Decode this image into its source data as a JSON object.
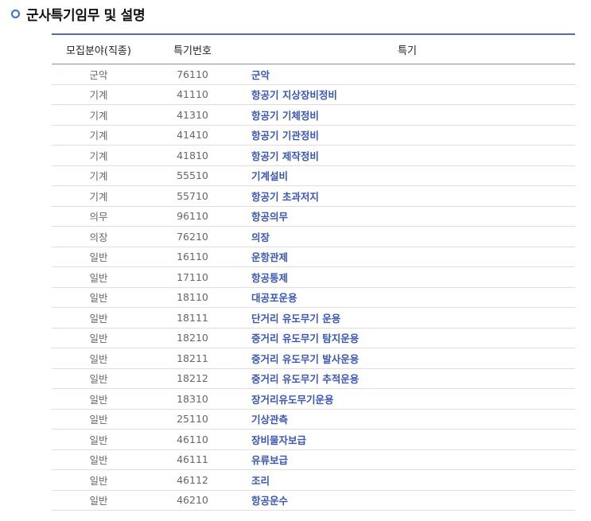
{
  "section": {
    "title": "군사특기임무 및 설명"
  },
  "table": {
    "headers": [
      "모집분야(직종)",
      "특기번호",
      "특기"
    ],
    "rows": [
      {
        "field": "군악",
        "code": "76110",
        "name": "군악"
      },
      {
        "field": "기계",
        "code": "41110",
        "name": "항공기 지상장비정비"
      },
      {
        "field": "기계",
        "code": "41310",
        "name": "항공기 기체정비"
      },
      {
        "field": "기계",
        "code": "41410",
        "name": "항공기 기관정비"
      },
      {
        "field": "기계",
        "code": "41810",
        "name": "항공기 제작정비"
      },
      {
        "field": "기계",
        "code": "55510",
        "name": "기계설비"
      },
      {
        "field": "기계",
        "code": "55710",
        "name": "항공기 초과저지"
      },
      {
        "field": "의무",
        "code": "96110",
        "name": "항공의무"
      },
      {
        "field": "의장",
        "code": "76210",
        "name": "의장"
      },
      {
        "field": "일반",
        "code": "16110",
        "name": "운항관제"
      },
      {
        "field": "일반",
        "code": "17110",
        "name": "항공통제"
      },
      {
        "field": "일반",
        "code": "18110",
        "name": "대공포운용"
      },
      {
        "field": "일반",
        "code": "18111",
        "name": "단거리 유도무기 운용"
      },
      {
        "field": "일반",
        "code": "18210",
        "name": "중거리 유도무기 탐지운용"
      },
      {
        "field": "일반",
        "code": "18211",
        "name": "중거리 유도무기 발사운용"
      },
      {
        "field": "일반",
        "code": "18212",
        "name": "중거리 유도무기 추적운용"
      },
      {
        "field": "일반",
        "code": "18310",
        "name": "장거리유도무기운용"
      },
      {
        "field": "일반",
        "code": "25110",
        "name": "기상관측"
      },
      {
        "field": "일반",
        "code": "46110",
        "name": "장비물자보급"
      },
      {
        "field": "일반",
        "code": "46111",
        "name": "유류보급"
      },
      {
        "field": "일반",
        "code": "46112",
        "name": "조리"
      },
      {
        "field": "일반",
        "code": "46210",
        "name": "항공운수"
      }
    ]
  }
}
